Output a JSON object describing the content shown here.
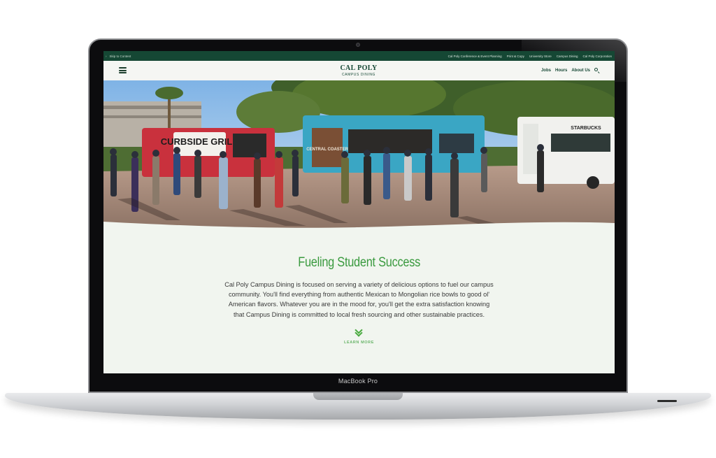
{
  "device": {
    "label": "MacBook Pro"
  },
  "utility_bar": {
    "skip_link": "Skip to Content",
    "links": [
      "Cal Poly Conference & Event Planning",
      "Print & Copy",
      "University Store",
      "Campus Dining",
      "Cal Poly Corporation"
    ]
  },
  "header": {
    "logo_main": "CAL POLY",
    "logo_sub": "CAMPUS DINING",
    "nav": [
      "Jobs",
      "Hours",
      "About Us"
    ]
  },
  "hero": {
    "truck_signs": [
      "CURBSIDE GRILL",
      "CENTRAL COASTER",
      "STARBUCKS"
    ]
  },
  "content": {
    "headline": "Fueling Student Success",
    "body": "Cal Poly Campus Dining is focused on serving a variety of delicious options to fuel our campus community. You'll find everything from authentic Mexican to Mongolian rice bowls to good ol' American flavors. Whatever you are in the mood for, you'll get the extra satisfaction knowing that Campus Dining is committed to local fresh sourcing and other sustainable practices.",
    "learn_more": "LEARN MORE"
  },
  "colors": {
    "brand_green": "#154734",
    "accent_green": "#3a9a3f",
    "page_background": "#f1f5ef"
  }
}
